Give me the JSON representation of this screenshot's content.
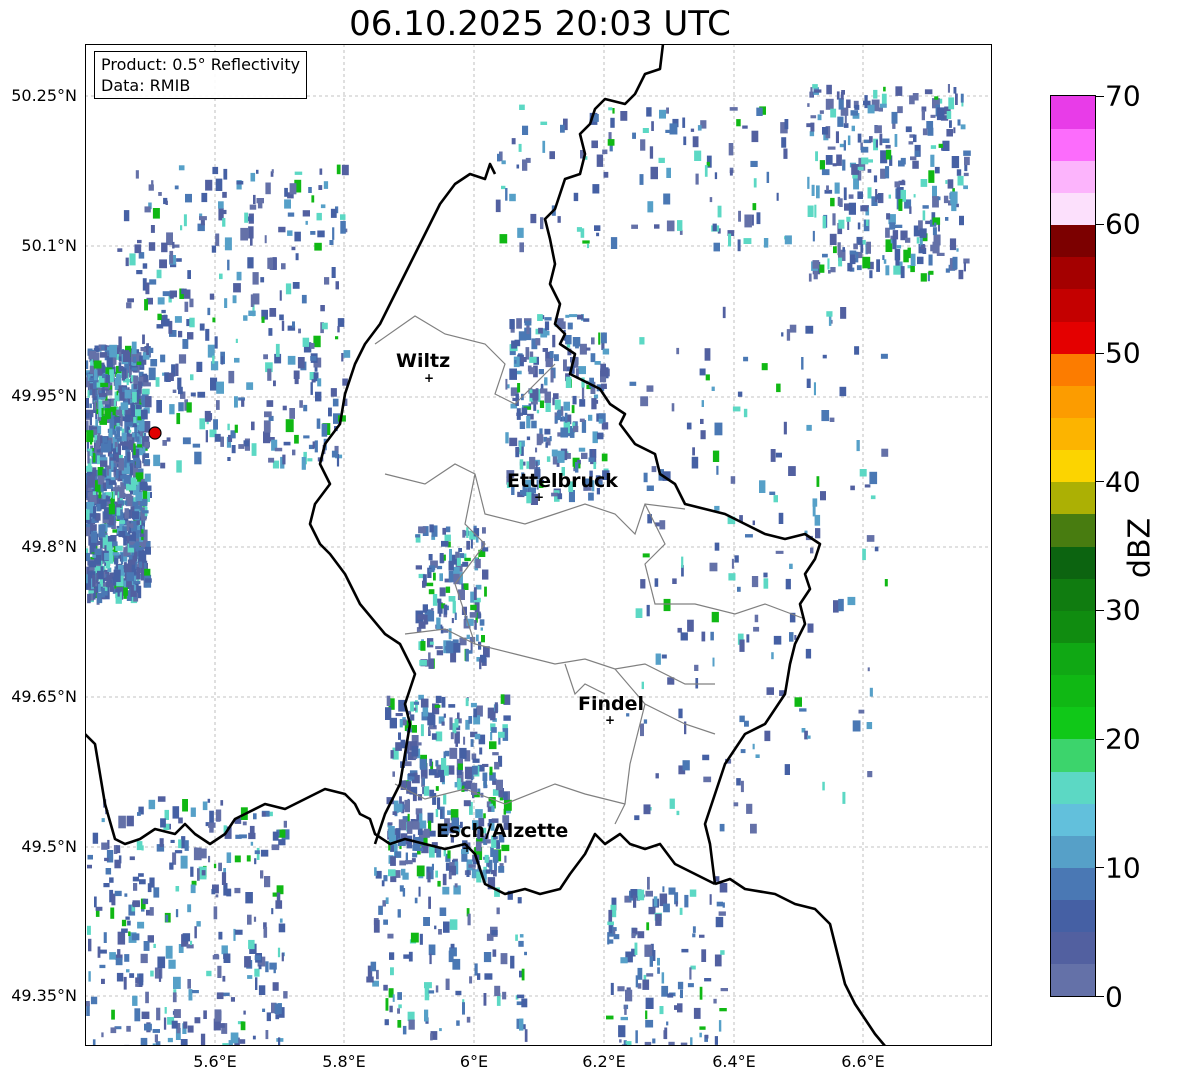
{
  "title": "06.10.2025 20:03 UTC",
  "info": {
    "product": "Product: 0.5° Reflectivity",
    "data": "Data: RMIB"
  },
  "latitude_labels": [
    "50.25°N",
    "50.1°N",
    "49.95°N",
    "49.8°N",
    "49.65°N",
    "49.5°N",
    "49.35°N"
  ],
  "longitude_labels": [
    "5.6°E",
    "5.8°E",
    "6°E",
    "6.2°E",
    "6.4°E",
    "6.6°E"
  ],
  "cities": [
    {
      "name": "Wiltz"
    },
    {
      "name": "Ettelbruck"
    },
    {
      "name": "Findel"
    },
    {
      "name": "Esch/Alzette"
    }
  ],
  "colorbar": {
    "label": "dBZ",
    "ticks": [
      "0",
      "10",
      "20",
      "30",
      "40",
      "50",
      "60",
      "70"
    ],
    "colors": [
      "#6471a8",
      "#5260a0",
      "#4560a4",
      "#4a78b4",
      "#56a0c8",
      "#62c0dc",
      "#5cd8c4",
      "#3cd46c",
      "#10c818",
      "#10b814",
      "#10a814",
      "#108c10",
      "#107c10",
      "#0c6410",
      "#487c10",
      "#acb004",
      "#fcd400",
      "#fcb400",
      "#fc9c00",
      "#fc7c00",
      "#e40000",
      "#c40000",
      "#a40000",
      "#7c0000",
      "#fce0fc",
      "#fcb4fc",
      "#fc6cfc",
      "#e83ce8"
    ]
  },
  "colors": {
    "radar_site": "#e00000",
    "border": "#000000",
    "district_border": "#808080",
    "grid": "#b0b0b0"
  }
}
